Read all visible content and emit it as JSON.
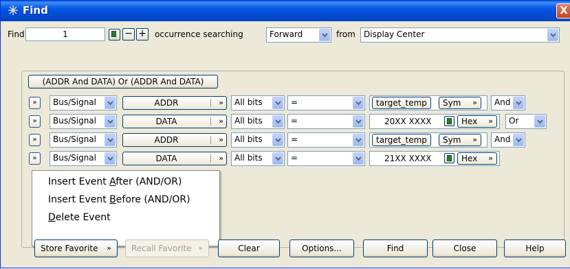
{
  "window": {
    "title": "Find",
    "close_glyph": "X"
  },
  "find_bar": {
    "find_label": "Find",
    "occurrence_value": "1",
    "minus_label": "−",
    "plus_label": "+",
    "occurrence_text": "occurrence searching",
    "direction_value": "Forward",
    "from_label": "from",
    "from_value": "Display Center"
  },
  "expression_button": "(ADDR And DATA) Or (ADDR And DATA)",
  "rows": [
    {
      "type": "Bus/Signal",
      "field": "ADDR",
      "bits": "All bits",
      "op": "=",
      "value": "target_temp",
      "fmt": "Sym",
      "logic": "And"
    },
    {
      "type": "Bus/Signal",
      "field": "DATA",
      "bits": "All bits",
      "op": "=",
      "value": "20XX XXXX",
      "fmt": "Hex",
      "logic": "Or"
    },
    {
      "type": "Bus/Signal",
      "field": "ADDR",
      "bits": "All bits",
      "op": "=",
      "value": "target_temp",
      "fmt": "Sym",
      "logic": "And"
    },
    {
      "type": "Bus/Signal",
      "field": "DATA",
      "bits": "All bits",
      "op": "=",
      "value": "21XX XXXX",
      "fmt": "Hex",
      "logic": ""
    }
  ],
  "context_menu": {
    "items": [
      {
        "pre": "Insert Event ",
        "key": "A",
        "post": "fter (AND/OR)"
      },
      {
        "pre": "Insert Event ",
        "key": "B",
        "post": "efore (AND/OR)"
      },
      {
        "pre": "",
        "key": "D",
        "post": "elete Event"
      }
    ]
  },
  "bottom_buttons": {
    "store_favorite": "Store Favorite",
    "recall_favorite": "Recall Favorite",
    "clear": "Clear",
    "options": "Options...",
    "find": "Find",
    "close": "Close",
    "help": "Help"
  },
  "icons": {
    "title": "find-sparkle-icon",
    "expand": "expand-chevron-icon",
    "calculator": "calculator-icon",
    "dropdown": "dropdown-arrow-icon"
  },
  "colors": {
    "titlebar": "#0554e3",
    "dialog_bg": "#ece9d8",
    "close": "#c5441f"
  }
}
